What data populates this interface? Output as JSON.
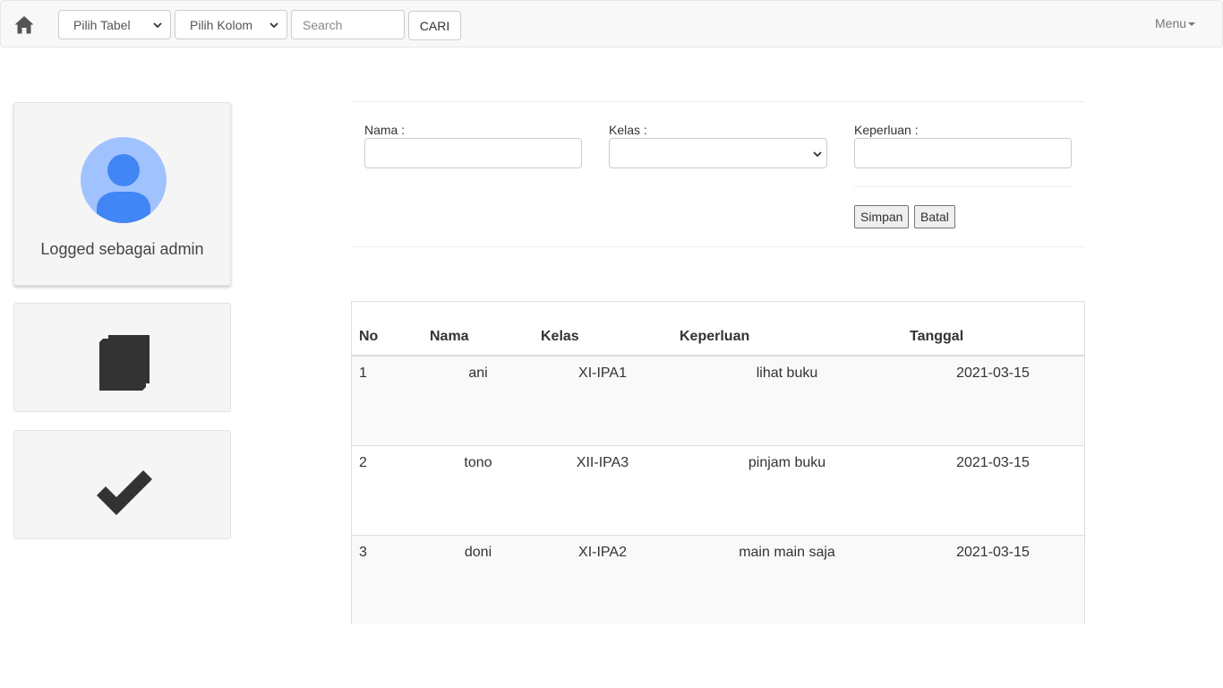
{
  "navbar": {
    "home_icon": "home-icon",
    "table_select": "Pilih Tabel",
    "column_select": "Pilih Kolom",
    "search_placeholder": "Search",
    "search_button": "CARI",
    "menu_label": "Menu"
  },
  "sidebar": {
    "profile_text": "Logged sebagai admin",
    "avatar_icon": "user-avatar-icon",
    "books_icon": "book-icon",
    "check_icon": "check-icon",
    "colors": {
      "avatar_bg": "#a0c3ff",
      "avatar_fg": "#4285f4"
    }
  },
  "form": {
    "nama_label": "Nama :",
    "kelas_label": "Kelas :",
    "keperluan_label": "Keperluan :",
    "save_button": "Simpan",
    "cancel_button": "Batal"
  },
  "table": {
    "headers": [
      "No",
      "Nama",
      "Kelas",
      "Keperluan",
      "Tanggal"
    ],
    "rows": [
      [
        "1",
        "ani",
        "XI-IPA1",
        "lihat buku",
        "2021-03-15"
      ],
      [
        "2",
        "tono",
        "XII-IPA3",
        "pinjam buku",
        "2021-03-15"
      ],
      [
        "3",
        "doni",
        "XI-IPA2",
        "main main saja",
        "2021-03-15"
      ]
    ]
  }
}
